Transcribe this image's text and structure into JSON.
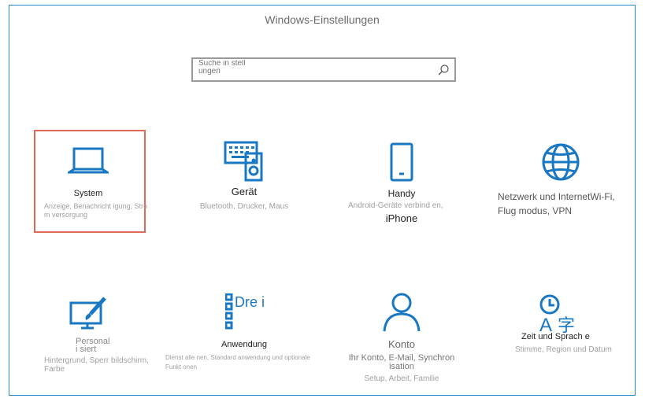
{
  "window": {
    "title": "Windows-Einstellungen"
  },
  "search": {
    "placeholder": "Suche in stell ungen"
  },
  "tiles": [
    {
      "name": "System",
      "description": "Anzeige, Benachricht igung, Stro m versorgung",
      "icon": "laptop-icon",
      "selected": true
    },
    {
      "name": "Gerät",
      "description": "Bluetooth, Drucker, Maus",
      "icon": "keyboard-speaker-icon"
    },
    {
      "name": "Handy",
      "description": "Android-Geräte verbind en,",
      "extra": "iPhone",
      "icon": "phone-icon"
    },
    {
      "name": "Netzwerk und InternetWi-Fi, Flug modus, VPN",
      "description": "",
      "icon": "globe-icon"
    },
    {
      "name": "Personal i siert",
      "description": "Hintergrund, Sperr bildschirm, Farbe",
      "icon": "paint-brush-icon"
    },
    {
      "name": "Anwendung",
      "description": "Dienst alle nen, Standard anwendung und optionale Funkt onen",
      "icon": "apps-list-icon",
      "icon_text": "Dre i"
    },
    {
      "name": "Konto",
      "description": "Ihr Konto, E-Mail, Synchron isation",
      "extra": "Setup, Arbeit, Familie",
      "icon": "person-icon"
    },
    {
      "name": "Zeit und Sprach e",
      "description": "Stimme, Region und Datum",
      "icon": "time-language-icon"
    }
  ],
  "colors": {
    "accent": "#1a78c2",
    "selection": "#e06a5a",
    "border": "#1f8ad0"
  }
}
